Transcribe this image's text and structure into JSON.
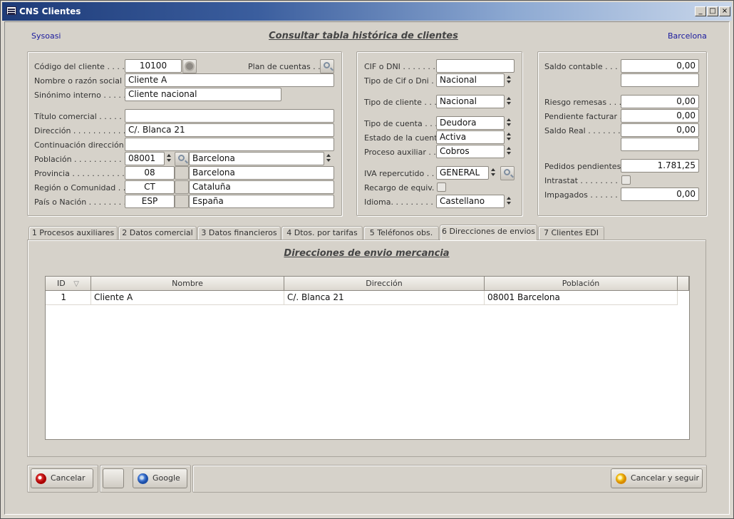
{
  "window": {
    "title": "CNS Clientes",
    "min": "_",
    "max": "□",
    "close": "×"
  },
  "header": {
    "company": "Sysoasi",
    "title": "Consultar tabla histórica de clientes",
    "city": "Barcelona"
  },
  "left": {
    "codigo_label": "Código del cliente . . . . .",
    "codigo_value": "10100",
    "plan_label": "Plan de cuentas . . .",
    "nombre_label": "Nombre o razón social . .",
    "nombre_value": "Cliente A",
    "sinonimo_label": "Sinónimo interno . . . . . .",
    "sinonimo_value": "Cliente nacional",
    "titulo_label": "Título comercial . . . . . . .",
    "titulo_value": "",
    "direccion_label": "Dirección . . . . . . . . . . .",
    "direccion_value": "C/. Blanca 21",
    "continuacion_label": "Continuación dirección . .",
    "continuacion_value": "",
    "poblacion_label": "Población . . . . . . . . . . .",
    "poblacion_code": "08001",
    "poblacion_name": "Barcelona",
    "provincia_label": "Provincia . . . . . . . . . . .",
    "provincia_code": "08",
    "provincia_name": "Barcelona",
    "region_label": "Región o Comunidad . . .",
    "region_code": "CT",
    "region_name": "Cataluña",
    "pais_label": "País o Nación . . . . . . . .",
    "pais_code": "ESP",
    "pais_name": "España"
  },
  "middle": {
    "cif_label": "CIF o DNI . . . . . . . .",
    "cif_value": "",
    "tipo_cif_label": "Tipo de Cif o Dni . . .",
    "tipo_cif_value": "Nacional",
    "tipo_cliente_label": "Tipo de cliente . . . .",
    "tipo_cliente_value": "Nacional",
    "tipo_cuenta_label": "Tipo de cuenta . . . .",
    "tipo_cuenta_value": "Deudora",
    "estado_label": "Estado de la cuenta . .",
    "estado_value": "Activa",
    "proceso_label": "Proceso auxiliar . . .",
    "proceso_value": "Cobros",
    "iva_label": "IVA repercutido . . .",
    "iva_value": "GENERAL",
    "recargo_label": "Recargo de equiv. . .",
    "idioma_label": "Idioma. . . . . . . . . . .",
    "idioma_value": "Castellano"
  },
  "right": {
    "saldo_contable_label": "Saldo contable . . . .",
    "saldo_contable_value": "0,00",
    "extra1_value": "",
    "riesgo_label": "Riesgo remesas . . .",
    "riesgo_value": "0,00",
    "pendiente_label": "Pendiente facturar .",
    "pendiente_value": "0,00",
    "saldo_real_label": "Saldo Real . . . . . . .",
    "saldo_real_value": "0,00",
    "extra2_value": "",
    "pedidos_label": "Pedidos pendientes .",
    "pedidos_value": "1.781,25",
    "intrastat_label": "Intrastat . . . . . . . .",
    "impagados_label": "Impagados . . . . . . .",
    "impagados_value": "0,00"
  },
  "tabs": [
    {
      "label": "1 Procesos auxiliares"
    },
    {
      "label": "2 Datos comercial"
    },
    {
      "label": "3 Datos financieros"
    },
    {
      "label": "4 Dtos. por tarifas"
    },
    {
      "label": "5 Teléfonos obs."
    },
    {
      "label": "6 Direcciones de envios"
    },
    {
      "label": "7 Clientes EDI"
    }
  ],
  "active_tab": 5,
  "envios": {
    "title": "Direcciones de envio mercancia",
    "columns": [
      "ID",
      "Nombre",
      "Dirección",
      "Población"
    ],
    "rows": [
      [
        "1",
        "Cliente A",
        "C/. Blanca 21",
        "08001 Barcelona"
      ]
    ]
  },
  "buttons": {
    "cancelar": "Cancelar",
    "blank": "",
    "google": "Google",
    "cancelar_seguir": "Cancelar y seguir"
  }
}
